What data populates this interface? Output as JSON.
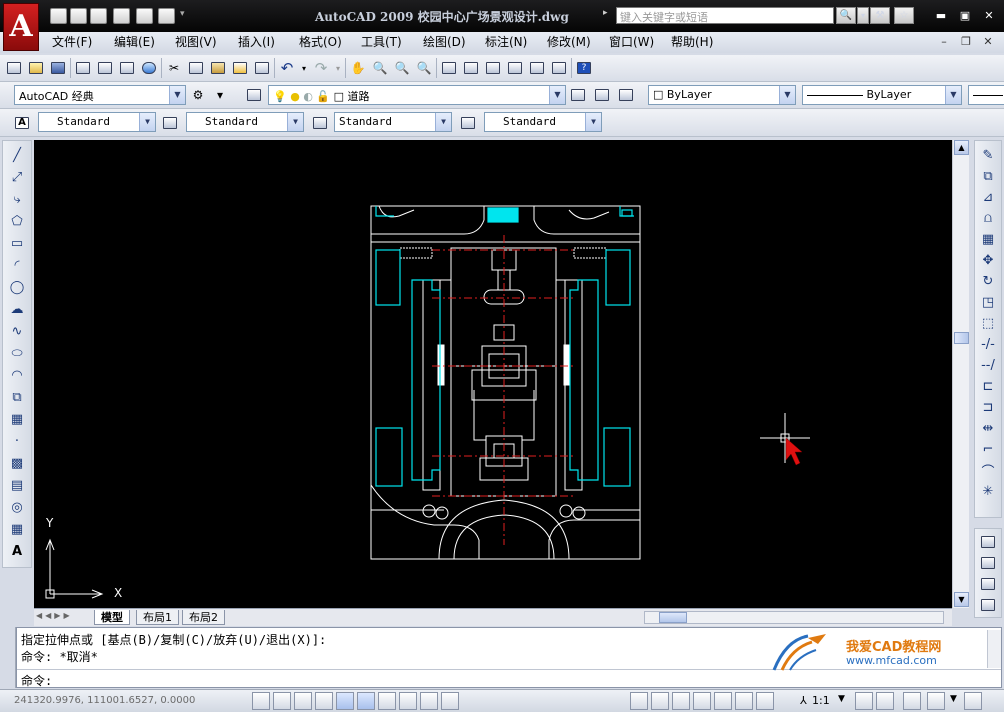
{
  "window": {
    "title": "AutoCAD 2009  校园中心广场景观设计.dwg",
    "search_placeholder": "键入关键字或短语",
    "controls": [
      "minimize-icon",
      "maximize-icon",
      "close-icon"
    ]
  },
  "menu": [
    "文件(F)",
    "编辑(E)",
    "视图(V)",
    "插入(I)",
    "格式(O)",
    "工具(T)",
    "绘图(D)",
    "标注(N)",
    "修改(M)",
    "窗口(W)",
    "帮助(H)"
  ],
  "toolbar2": {
    "workspace": "AutoCAD 经典",
    "layer": "道路",
    "color": "ByLayer",
    "linetype": "ByLayer"
  },
  "styles": {
    "text_style": "Standard",
    "dim_style": "Standard",
    "table_style": "Standard",
    "multileader_style": "Standard"
  },
  "tabs": [
    "模型",
    "布局1",
    "布局2"
  ],
  "command": {
    "line1": "指定拉伸点或 [基点(B)/复制(C)/放弃(U)/退出(X)]:",
    "line2": "命令: *取消*",
    "prompt": "命令:"
  },
  "watermark": {
    "brand": "我爱CAD教程网",
    "url": "www.mfcad.com"
  },
  "status": {
    "coords": "241320.9976, 111001.6527, 0.0000",
    "annotation_scale": "1:1"
  },
  "ucs": {
    "x_label": "X",
    "y_label": "Y"
  },
  "colors": {
    "drawing_bg": "#000000",
    "white_lines": "#ffffff",
    "cyan_lines": "#00e5ee",
    "red_centerlines": "#e02020",
    "cursor_red": "#e01010"
  }
}
